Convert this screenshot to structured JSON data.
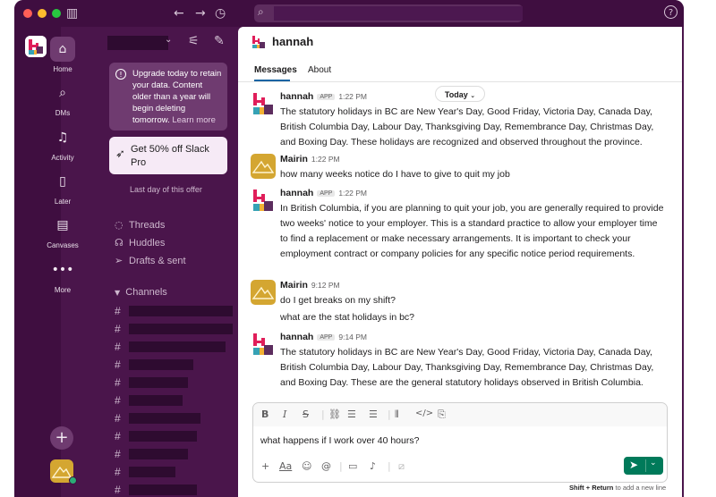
{
  "rail": {
    "items": [
      {
        "label": "Home",
        "icon": "home-icon"
      },
      {
        "label": "DMs",
        "icon": "dms-icon"
      },
      {
        "label": "Activity",
        "icon": "bell-icon"
      },
      {
        "label": "Later",
        "icon": "bookmark-icon"
      },
      {
        "label": "Canvases",
        "icon": "canvas-icon"
      },
      {
        "label": "More",
        "icon": "ellipsis-icon"
      }
    ]
  },
  "sidebar": {
    "upgrade_text": "Upgrade today to retain your data. Content older than a year will begin deleting tomorrow.",
    "learn_more": "Learn more",
    "offer": "Get 50% off Slack Pro",
    "last_day": "Last day of this offer",
    "links": [
      "Threads",
      "Huddles",
      "Drafts & sent"
    ],
    "channels_label": "Channels"
  },
  "header": {
    "title": "hannah",
    "tabs": [
      "Messages",
      "About"
    ]
  },
  "date_divider": "Today",
  "messages": [
    {
      "name": "hannah",
      "badge": "APP",
      "time": "1:22 PM",
      "text": "The statutory holidays in BC are New Year's Day, Good Friday, Victoria Day, Canada Day, British Columbia Day, Labour Day, Thanksgiving Day, Remembrance Day, Christmas Day, and Boxing Day. These holidays are recognized and observed throughout the province."
    },
    {
      "name": "Mairin",
      "time": "1:22 PM",
      "text": "how many weeks notice do I have to give to quit my job"
    },
    {
      "name": "hannah",
      "badge": "APP",
      "time": "1:22 PM",
      "text": "In British Columbia, if you are planning to quit your job, you are generally required to provide two weeks' notice to your employer. This is a standard practice to allow your employer time to find a replacement or make necessary arrangements. It is important to check your employment contract or company policies for any specific notice period requirements."
    },
    {
      "name": "Mairin",
      "time": "9:12 PM",
      "text": "do I get breaks on my shift?",
      "extra": "what are the stat holidays in bc?"
    },
    {
      "name": "hannah",
      "badge": "APP",
      "time": "9:14 PM",
      "text": "The statutory holidays in BC are New Year's Day, Good Friday, Victoria Day, Canada Day, British Columbia Day, Labour Day, Thanksgiving Day, Remembrance Day, Christmas Day, and Boxing Day. These are the general statutory holidays observed in British Columbia."
    }
  ],
  "composer": {
    "text": "what happens if I work over 40 hours?",
    "hint_keys": "Shift + Return",
    "hint_rest": "to add a new line"
  },
  "colors": {
    "aubergine": "#4a154b",
    "send_green": "#007a5a",
    "user_avatar": "#d4a631"
  }
}
